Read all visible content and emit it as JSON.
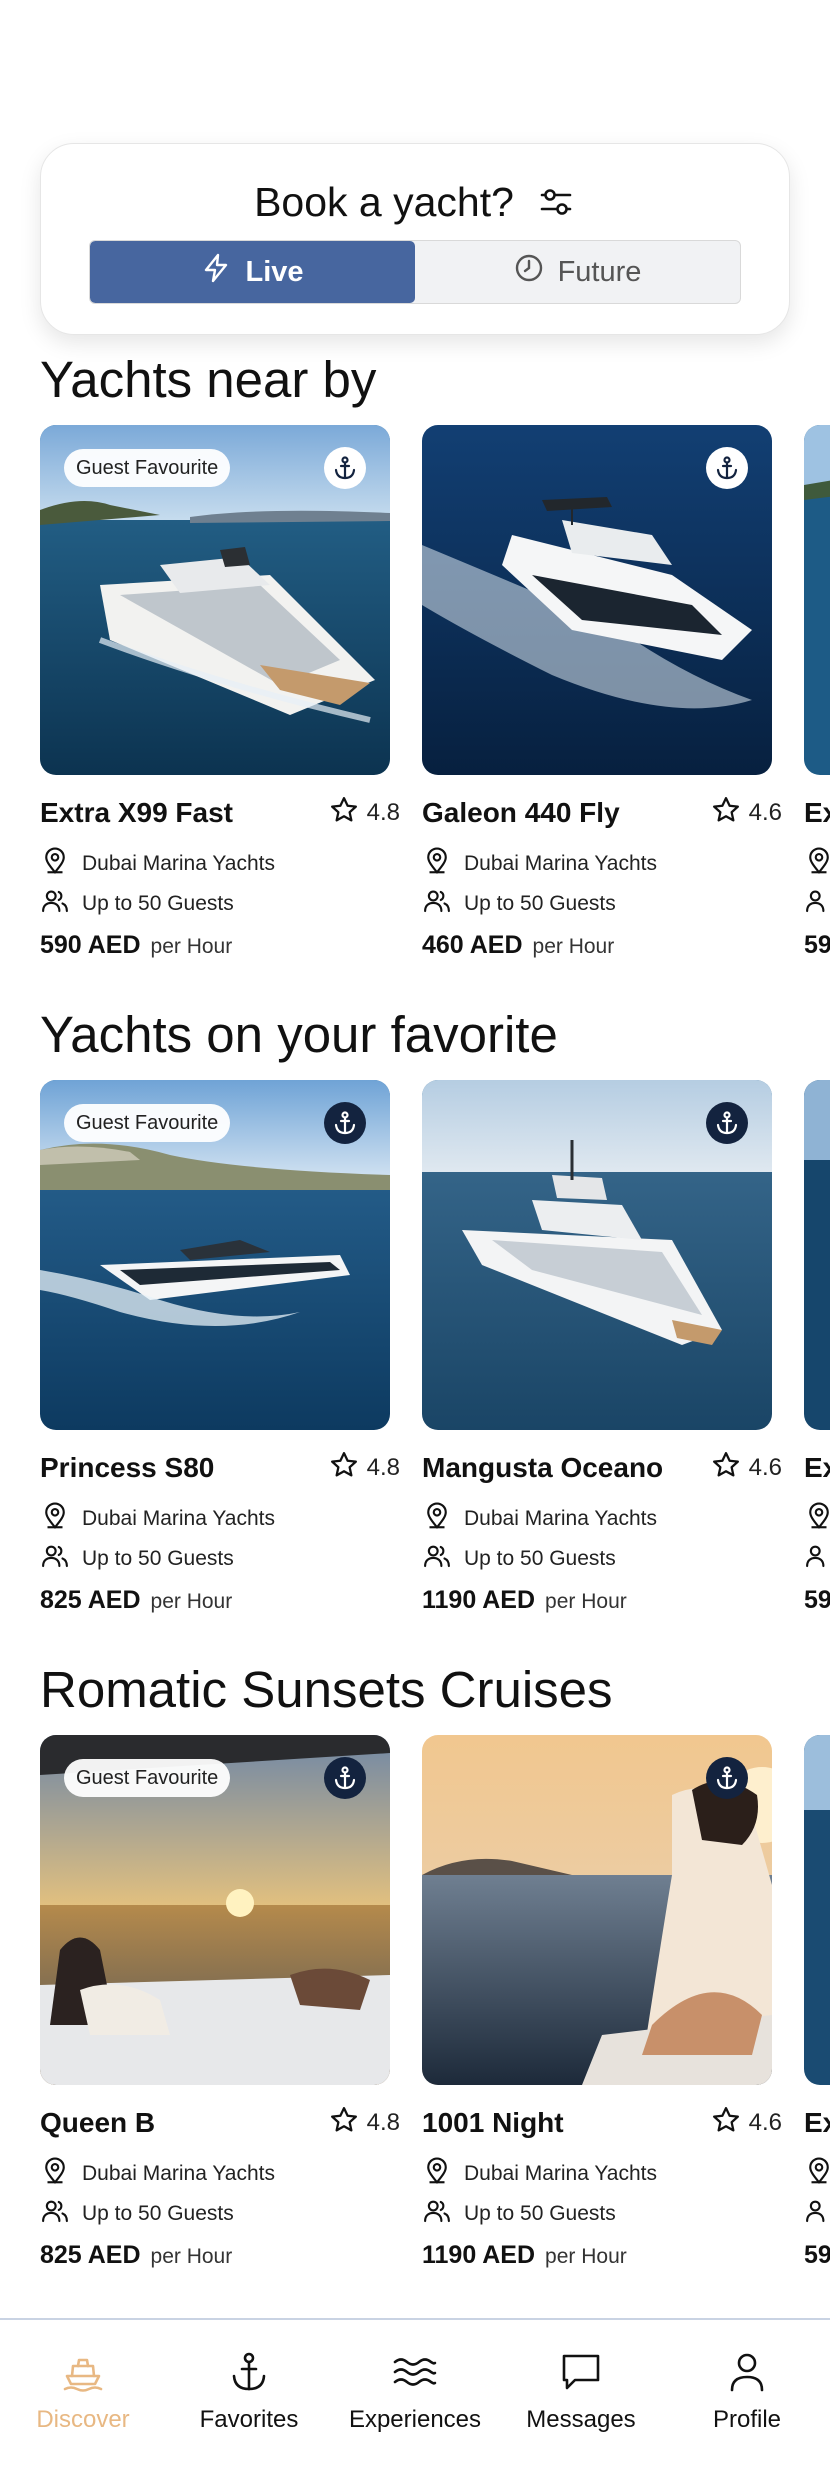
{
  "booking": {
    "title": "Book a yacht?",
    "filter_icon": "sliders-icon",
    "toggle": [
      {
        "label": "Live",
        "icon": "lightning-icon",
        "active": true
      },
      {
        "label": "Future",
        "icon": "clock-icon",
        "active": false
      }
    ]
  },
  "sections": [
    {
      "title": "Yachts near by",
      "cards": [
        {
          "badge": "Guest Favourite",
          "name": "Extra X99 Fast",
          "rating": "4.8",
          "location": "Dubai Marina Yachts",
          "guests": "Up to 50 Guests",
          "price": "590 AED",
          "per": "per Hour"
        },
        {
          "badge": "",
          "name": "Galeon 440 Fly",
          "rating": "4.6",
          "location": "Dubai Marina Yachts",
          "guests": "Up to 50 Guests",
          "price": "460 AED",
          "per": "per Hour"
        },
        {
          "badge": "",
          "name": "Ex",
          "rating": "",
          "location": "",
          "guests": "",
          "price": "59",
          "per": ""
        }
      ]
    },
    {
      "title": "Yachts on your favorite",
      "cards": [
        {
          "badge": "Guest Favourite",
          "name": "Princess S80",
          "rating": "4.8",
          "location": "Dubai Marina Yachts",
          "guests": "Up to 50 Guests",
          "price": "825 AED",
          "per": "per Hour"
        },
        {
          "badge": "",
          "name": "Mangusta Oceano",
          "rating": "4.6",
          "location": "Dubai Marina Yachts",
          "guests": "Up to 50 Guests",
          "price": "1190 AED",
          "per": "per Hour"
        },
        {
          "badge": "",
          "name": "Ex",
          "rating": "",
          "location": "",
          "guests": "",
          "price": "59",
          "per": ""
        }
      ]
    },
    {
      "title": "Romatic Sunsets Cruises",
      "cards": [
        {
          "badge": "Guest Favourite",
          "name": "Queen B",
          "rating": "4.8",
          "location": "Dubai Marina Yachts",
          "guests": "Up to 50 Guests",
          "price": "825 AED",
          "per": "per Hour"
        },
        {
          "badge": "",
          "name": "1001 Night",
          "rating": "4.6",
          "location": "Dubai Marina Yachts",
          "guests": "Up to 50 Guests",
          "price": "1190 AED",
          "per": "per Hour"
        },
        {
          "badge": "",
          "name": "Ex",
          "rating": "",
          "location": "",
          "guests": "",
          "price": "59",
          "per": ""
        }
      ]
    }
  ],
  "nav": [
    {
      "label": "Discover",
      "icon": "boat-icon",
      "active": true
    },
    {
      "label": "Favorites",
      "icon": "anchor-icon",
      "active": false
    },
    {
      "label": "Experiences",
      "icon": "waves-icon",
      "active": false
    },
    {
      "label": "Messages",
      "icon": "chat-icon",
      "active": false
    },
    {
      "label": "Profile",
      "icon": "user-icon",
      "active": false
    }
  ],
  "colors": {
    "accent": "#47669f",
    "nav_active": "#e8b883",
    "anchor_dark": "#13233f"
  }
}
